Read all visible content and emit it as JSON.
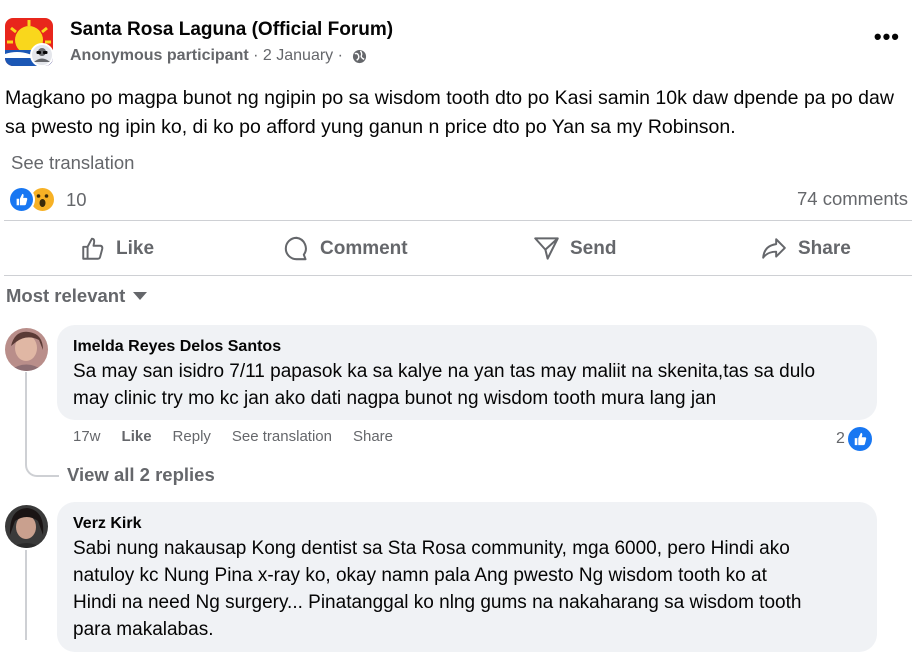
{
  "post": {
    "group_name": "Santa Rosa Laguna (Official Forum)",
    "author": "Anonymous participant",
    "separator": " · ",
    "date": "2 January",
    "separator2": " · ",
    "text": "Magkano po magpa bunot ng ngipin po sa wisdom tooth dto po Kasi samin 10k daw dpende pa po daw sa pwesto ng ipin ko, di ko po afford yung ganun n price dto po Yan sa my Robinson.",
    "see_translation": "See translation",
    "reaction_count": "10",
    "comments_count": "74 comments",
    "more_icon": "more-options-icon",
    "privacy_icon": "globe-icon"
  },
  "actions": {
    "like": "Like",
    "comment": "Comment",
    "send": "Send",
    "share": "Share"
  },
  "filter": {
    "label": "Most relevant"
  },
  "comments": [
    {
      "author": "Imelda Reyes Delos Santos",
      "line1": "Sa may san isidro 7/11 papasok ka sa kalye na yan tas may maliit na skenita,tas sa dulo",
      "line2": "may clinic try mo kc jan ako dati nagpa bunot ng wisdom tooth mura lang jan",
      "time": "17w",
      "like": "Like",
      "reply": "Reply",
      "see_translation": "See translation",
      "share": "Share",
      "like_count": "2",
      "view_replies": "View all 2 replies"
    },
    {
      "author": "Verz Kirk",
      "line1": "Sabi nung nakausap Kong dentist sa Sta Rosa community, mga 6000, pero Hindi ako",
      "line2": "natuloy kc Nung Pina x-ray ko, okay namn pala Ang pwesto Ng wisdom tooth ko at",
      "line3": "Hindi na need Ng surgery... Pinatanggal ko nlng gums na nakaharang sa wisdom tooth",
      "line4": "para makalabas."
    }
  ],
  "colors": {
    "facebook_blue": "#1877f2",
    "secondary_text": "#65676b",
    "bubble": "#f0f2f5",
    "wow_yellow": "#f7b125"
  }
}
